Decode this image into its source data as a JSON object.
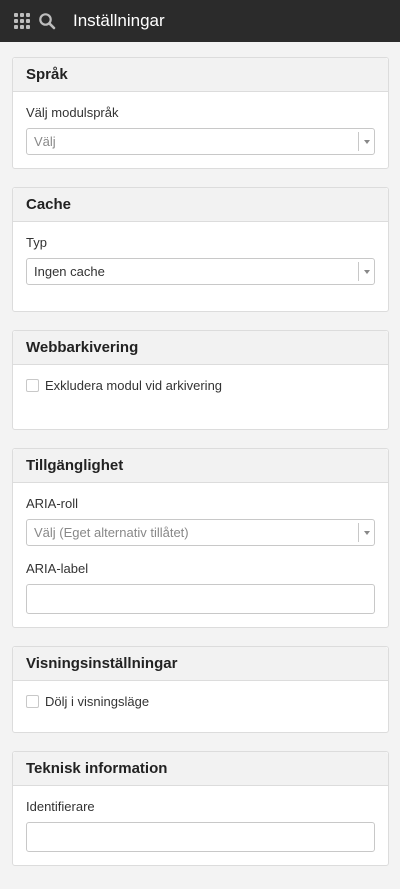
{
  "header": {
    "title": "Inställningar",
    "apps_icon": "grid-icon",
    "search_icon": "search-icon"
  },
  "sections": {
    "language": {
      "title": "Språk",
      "label": "Välj modulspråk",
      "placeholder": "Välj"
    },
    "cache": {
      "title": "Cache",
      "label": "Typ",
      "value": "Ingen cache"
    },
    "archiving": {
      "title": "Webbarkivering",
      "checkbox_label": "Exkludera modul vid arkivering"
    },
    "accessibility": {
      "title": "Tillgänglighet",
      "role_label": "ARIA-roll",
      "role_placeholder": "Välj (Eget alternativ tillåtet)",
      "aria_label_label": "ARIA-label",
      "aria_label_value": ""
    },
    "display": {
      "title": "Visningsinställningar",
      "checkbox_label": "Dölj i visningsläge"
    },
    "technical": {
      "title": "Teknisk information",
      "identifier_label": "Identifierare",
      "identifier_value": ""
    }
  }
}
